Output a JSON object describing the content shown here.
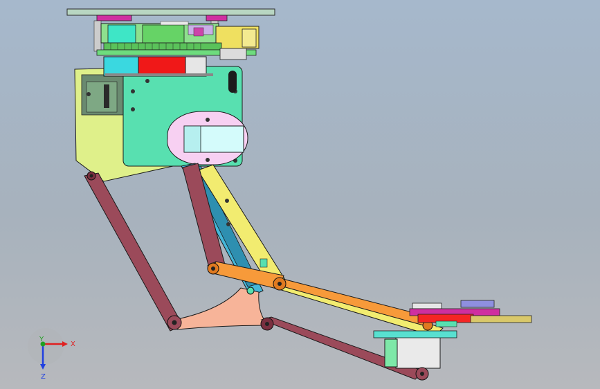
{
  "window": {
    "type": "cad-3d-viewport"
  },
  "triad": {
    "x_label": "X",
    "y_label": "Y",
    "z_label": "Z",
    "colors": {
      "x": "#e02020",
      "y": "#20a020",
      "z": "#2040e0"
    }
  },
  "colors": {
    "background_top": "#a6b8cc",
    "background_bottom": "#b7b9bd",
    "top_plate": "#b8d6c2",
    "pcb_green": "#8ee08e",
    "side_plate_yellow": "#dff08a",
    "main_plate_teal": "#58e0b0",
    "servo_cyan": "#3ad8e0",
    "servo_red": "#f01818",
    "link_maroon": "#9b4a5a",
    "link_yellow": "#f2ec70",
    "link_orange": "#f79a3a",
    "triangle_salmon": "#f7b499",
    "slot_pink": "#f7d0f2",
    "slot_cyan": "#d4fbfb",
    "magenta": "#cf2fa0",
    "motor_white": "#eaeaea",
    "connector_yellow": "#efe060",
    "end_effector_red": "#f52525"
  },
  "parts": [
    "top-plate",
    "pcb-stack",
    "side-plate",
    "main-plate",
    "servo-cyan",
    "servo-red",
    "slot-bracket",
    "left-outer-link",
    "left-lower-link",
    "yellow-link",
    "orange-link",
    "triangle-joint",
    "lower-link",
    "end-effector",
    "motor-body",
    "gear-stack"
  ]
}
